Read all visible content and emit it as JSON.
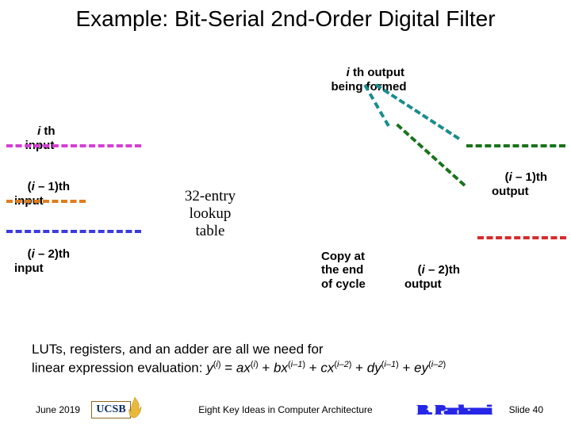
{
  "title": "Example: Bit-Serial 2nd-Order Digital Filter",
  "labels": {
    "ith_output": "i th output\nbeing formed",
    "ith_input": "i th\ninput",
    "im1_input": "(i – 1)th\ninput",
    "im2_input": "(i – 2)th\ninput",
    "lut": "32-entry\nlookup\ntable",
    "copy": "Copy at\nthe end\nof cycle",
    "im1_output": "(i – 1)th\noutput",
    "im2_output": "(i – 2)th\noutput"
  },
  "i_glyph": "i",
  "summary": {
    "line1": "LUTs, registers, and an adder are all we need for",
    "line2_prefix": "linear expression evaluation: ",
    "eq_parts": {
      "y": "y",
      "eq": " = ",
      "a": "a",
      "x": "x",
      "plus": " + ",
      "b": "b",
      "c": "c",
      "d": "d",
      "e": "e",
      "sup_i": "i",
      "sup_im1": "i–1",
      "sup_im2": "i–2"
    }
  },
  "footer": {
    "date": "June 2019",
    "center": "Eight Key Ideas in Computer Architecture",
    "slide": "Slide 40",
    "ucsb": "UCSB",
    "sig": "B. Parhami"
  },
  "chart_data": {
    "type": "diagram",
    "nodes": [
      {
        "id": "ith_input",
        "role": "input",
        "tag": "x(i)"
      },
      {
        "id": "im1_input",
        "role": "input",
        "tag": "x(i-1)"
      },
      {
        "id": "im2_input",
        "role": "input",
        "tag": "x(i-2)"
      },
      {
        "id": "lut",
        "role": "lookup-table",
        "entries": 32
      },
      {
        "id": "ith_output",
        "role": "output-accum",
        "tag": "y(i)"
      },
      {
        "id": "im1_output",
        "role": "output",
        "tag": "y(i-1)"
      },
      {
        "id": "im2_output",
        "role": "output",
        "tag": "y(i-2)"
      },
      {
        "id": "copy",
        "role": "note",
        "text": "Copy at the end of cycle"
      }
    ],
    "edges": [
      {
        "from": "ith_input",
        "to": "lut",
        "color": "#d63fd6"
      },
      {
        "from": "im1_input",
        "to": "lut",
        "color": "#e07c1e"
      },
      {
        "from": "im2_input",
        "to": "lut",
        "color": "#3a3ae0"
      },
      {
        "from": "lut",
        "to": "ith_output",
        "color": "#1a8c8c"
      },
      {
        "from": "im1_output",
        "to": "lut",
        "color": "#1a731a"
      },
      {
        "from": "im2_output",
        "to": "lut",
        "color": "#d62c2c"
      }
    ],
    "equation": "y(i) = a·x(i) + b·x(i-1) + c·x(i-2) + d·y(i-1) + e·y(i-2)"
  }
}
